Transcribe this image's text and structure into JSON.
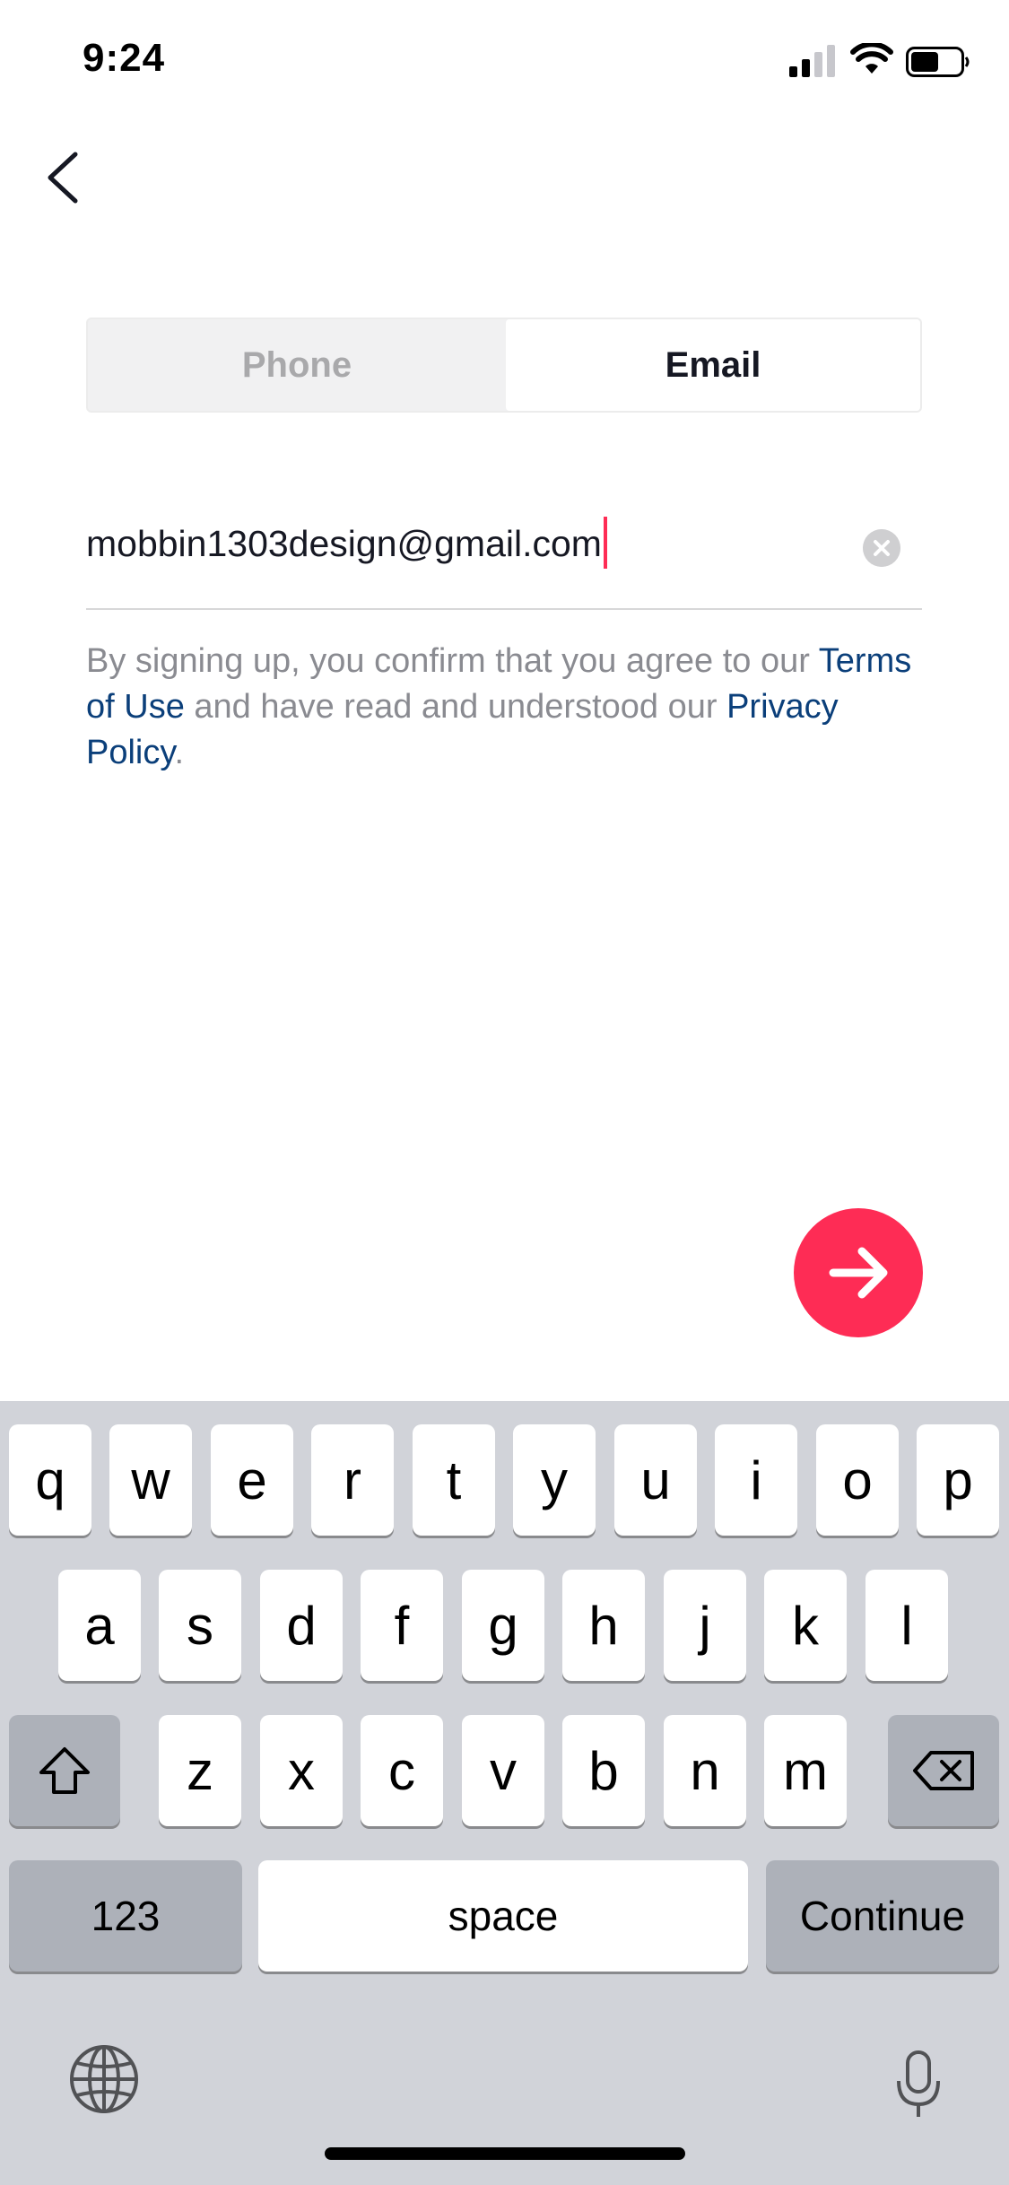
{
  "status_bar": {
    "time": "9:24"
  },
  "tabs": [
    {
      "label": "Phone",
      "selected": false
    },
    {
      "label": "Email",
      "selected": true
    }
  ],
  "email_input": {
    "value": "mobbin1303design@gmail.com"
  },
  "terms": {
    "text_before": "By signing up, you confirm that you agree to our ",
    "terms_link": "Terms of Use",
    "text_middle": " and have read and understood our ",
    "privacy_link": "Privacy Policy",
    "text_after": "."
  },
  "colors": {
    "accent": "#fe2c55",
    "link": "#0b3f7a"
  },
  "keyboard": {
    "row1": [
      "q",
      "w",
      "e",
      "r",
      "t",
      "y",
      "u",
      "i",
      "o",
      "p"
    ],
    "row2": [
      "a",
      "s",
      "d",
      "f",
      "g",
      "h",
      "j",
      "k",
      "l"
    ],
    "row3": [
      "z",
      "x",
      "c",
      "v",
      "b",
      "n",
      "m"
    ],
    "numbers_label": "123",
    "space_label": "space",
    "return_label": "Continue"
  }
}
